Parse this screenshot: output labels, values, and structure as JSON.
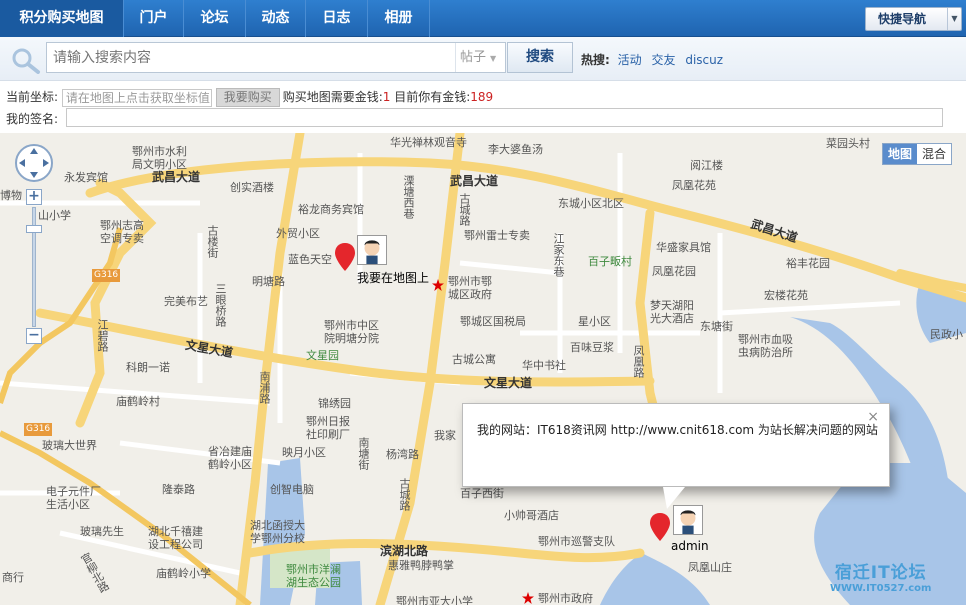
{
  "nav": {
    "items": [
      "积分购买地图",
      "门户",
      "论坛",
      "动态",
      "日志",
      "相册"
    ],
    "quick_nav_label": "快捷导航"
  },
  "search": {
    "placeholder": "请输入搜索内容",
    "type_selected": "帖子",
    "button_label": "搜索",
    "hot_label": "热搜:",
    "hot_links": [
      "活动",
      "交友",
      "discuz"
    ]
  },
  "coord": {
    "label": "当前坐标:",
    "input_placeholder": "请在地图上点击获取坐标值",
    "buy_button": "我要购买",
    "price_text": "购买地图需要金钱:",
    "price_value": "1",
    "balance_text": "目前你有金钱:",
    "balance_value": "189"
  },
  "signature": {
    "label": "我的签名:"
  },
  "map": {
    "type_options": [
      "地图",
      "混合"
    ],
    "type_selected": "地图",
    "zoom_in": "+",
    "zoom_out": "−",
    "markers": [
      {
        "label": "我要在地图上"
      },
      {
        "label": "admin"
      }
    ],
    "popup_text": "我的网站：IT618资讯网 http://www.cnit618.com 为站长解决问题的网站",
    "popup_close": "×",
    "watermark_title": "宿迁IT论坛",
    "watermark_url": "WWW.IT0527.com",
    "roads": {
      "wuchang_west": "武昌大道",
      "wuchang_mid": "武昌大道",
      "wuchang_east": "武昌大道",
      "wenxing_west": "文星大道",
      "wenxing_east": "文星大道",
      "binhu": "滨湖北路",
      "mingtang": "明塘路",
      "longtai": "隆泰路",
      "donglian": "东塘街",
      "baizi": "百子西街",
      "gucheng1": "古城路",
      "gucheng2": "古城路",
      "jiangbi": "江碧路",
      "nanpu": "南浦路",
      "fenghuang": "凤凰路",
      "guanliu": "官柳北路",
      "lixi": "溧塘西巷",
      "gulou": "古楼街",
      "sanyanqiao": "三眼桥路",
      "nantang": "南塘街",
      "yangtang": "杨湾路",
      "jiangjia": "江家东巷",
      "g316a": "G316",
      "g316b": "G316"
    },
    "pois": [
      "华光禅林观音寺",
      "李大婆鱼汤",
      "阅江楼",
      "菜园头村",
      "鄂州市水利局文明小区",
      "永发宾馆",
      "创实酒楼",
      "凤凰花苑",
      "东城小区北区",
      "裕龙商务宾馆",
      "山小学",
      "鄂州志高空调专卖",
      "外贸小区",
      "鄂州雷士专卖",
      "华盛家具馆",
      "裕丰花园",
      "蓝色天空",
      "百子畈村",
      "凤凰花园",
      "鄂州市鄂城区政府",
      "完美布艺",
      "宏楼花苑",
      "梦天湖阳光大酒店",
      "鄂州市中区院明塘分院",
      "鄂城区国税局",
      "星小区",
      "鄂州市血吸虫病防治所",
      "民政小",
      "文星园",
      "古城公寓",
      "百味豆浆",
      "科朗一诺",
      "华中书社",
      "庙鹤岭村",
      "锦绣园",
      "鄂州日报社印刷厂",
      "省冶建庙鹤岭小区",
      "映月小区",
      "我家",
      "玻璃大世界",
      "创智电脑",
      "电子元件厂生活小区",
      "玻璃先生",
      "湖北千禧建设工程公司",
      "湖北函授大学鄂州分校",
      "小帅哥酒店",
      "鄂州市巡警支队",
      "凤凰山庄",
      "商行",
      "庙鹤岭小学",
      "鄂州市洋澜湖生态公园",
      "惠雅鸭脖鸭掌",
      "鄂州市政府",
      "鄂州市亚大小学",
      "博物"
    ]
  }
}
